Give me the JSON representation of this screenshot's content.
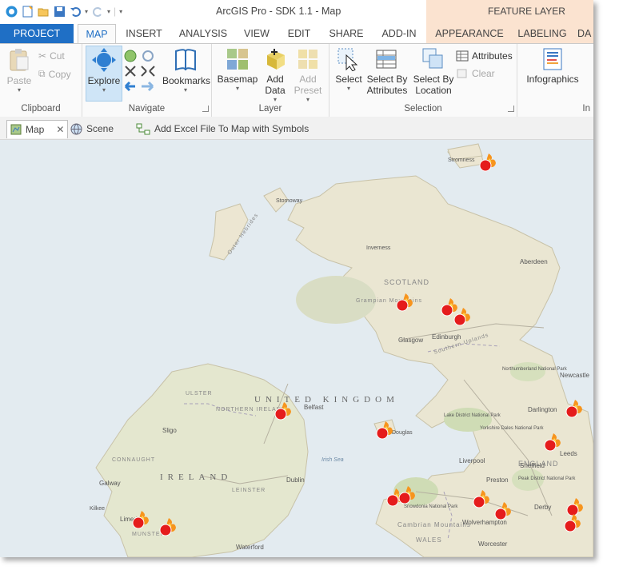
{
  "window": {
    "title": "ArcGIS Pro - SDK 1.1 - Map",
    "contextual_title": "FEATURE LAYER"
  },
  "tabs": [
    "PROJECT",
    "MAP",
    "INSERT",
    "ANALYSIS",
    "VIEW",
    "EDIT",
    "SHARE",
    "ADD-IN",
    "APPEARANCE",
    "LABELING",
    "DA"
  ],
  "ribbon": {
    "clipboard": {
      "label": "Clipboard",
      "paste": "Paste",
      "cut": "Cut",
      "copy": "Copy"
    },
    "navigate": {
      "label": "Navigate",
      "explore": "Explore",
      "bookmarks": "Bookmarks"
    },
    "layer": {
      "label": "Layer",
      "basemap": "Basemap",
      "add_data_1": "Add",
      "add_data_2": "Data",
      "add_preset_1": "Add",
      "add_preset_2": "Preset"
    },
    "selection": {
      "label": "Selection",
      "select": "Select",
      "select_by_attr_1": "Select By",
      "select_by_attr_2": "Attributes",
      "select_by_loc_1": "Select By",
      "select_by_loc_2": "Location",
      "attributes": "Attributes",
      "clear": "Clear"
    },
    "infographics": {
      "label": "In",
      "infographics": "Infographics"
    }
  },
  "view_tabs": {
    "map": "Map",
    "scene": "Scene",
    "addin": "Add Excel File To Map with Symbols"
  },
  "map": {
    "country_labels": {
      "uk": "UNITED KINGDOM",
      "ireland": "IRELAND",
      "scotland": "SCOTLAND",
      "england": "ENGLAND",
      "wales": "WALES"
    },
    "region_labels": {
      "ulster": "ULSTER",
      "northern_ireland": "NORTHERN IRELAND",
      "connaught": "CONNAUGHT",
      "leinster": "LEINSTER",
      "munster": "MUNSTER",
      "outer_hebrides": "Outer Hebrides",
      "southern_uplands": "Southern Uplands",
      "northumberland": "Northumberland National Park",
      "lake_district": "Lake District National Park",
      "yorkshire_dales": "Yorkshire Dales National Park",
      "peak_district": "Peak District National Park",
      "snowdonia": "Snowdonia National Park",
      "cambrian": "Cambrian Mountains",
      "irish_sea": "Irish Sea",
      "grampian": "Grampian Mountains"
    },
    "cities": {
      "aberdeen": "Aberdeen",
      "edinburgh": "Edinburgh",
      "glasgow": "Glasgow",
      "belfast": "Belfast",
      "dublin": "Dublin",
      "newcastle": "Newcastle",
      "darlington": "Darlington",
      "leeds": "Leeds",
      "liverpool": "Liverpool",
      "wolverhampton": "Wolverhampton",
      "derby": "Derby",
      "sligo": "Sligo",
      "galway": "Galway",
      "limerick": "Limerick",
      "waterford": "Waterford",
      "stornoway": "Stornoway",
      "inverness": "Inverness",
      "worcester": "Worcester",
      "preston": "Preston",
      "sheffield": "Sheffield",
      "douglas": "Douglas",
      "kilkee": "Kilkee",
      "lerwick": "Stromness"
    }
  },
  "colors": {
    "accent": "#1f6fc5",
    "contextual": "#fbe3d0",
    "fire_outer": "#f7941d",
    "fire_inner": "#e51c1c"
  },
  "icons": [
    "arcgis-logo-icon",
    "new-icon",
    "open-icon",
    "save-icon",
    "undo-icon",
    "redo-icon",
    "paste-icon",
    "cut-icon",
    "copy-icon",
    "explore-icon",
    "bookmarks-icon",
    "basemap-icon",
    "add-data-icon",
    "add-preset-icon",
    "select-icon",
    "select-by-attributes-icon",
    "select-by-location-icon",
    "attributes-icon",
    "clear-icon",
    "infographics-icon",
    "map-tab-icon",
    "close-icon",
    "globe-icon",
    "addin-icon",
    "fire-icon"
  ]
}
